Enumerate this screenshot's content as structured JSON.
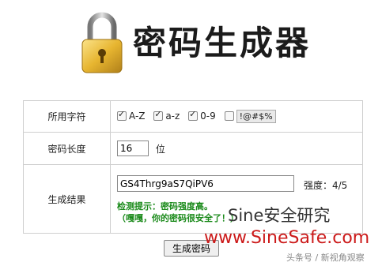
{
  "header": {
    "title": "密码生成器",
    "icon": "padlock-icon"
  },
  "form": {
    "charset": {
      "label": "所用字符",
      "options": [
        {
          "label": "A-Z",
          "checked": true
        },
        {
          "label": "a-z",
          "checked": true
        },
        {
          "label": "0-9",
          "checked": true
        },
        {
          "label": "!@#$%",
          "checked": false
        }
      ]
    },
    "length": {
      "label": "密码长度",
      "value": "16",
      "unit": "位"
    },
    "result": {
      "label": "生成结果",
      "password": "GS4Thrg9aS7QiPV6",
      "strength": "强度：4/5",
      "tip_line1": "检测提示：密码强度高。",
      "tip_line2": "（嘎嘎，你的密码很安全了！）"
    }
  },
  "actions": {
    "generate_label": "生成密码"
  },
  "watermark": {
    "brand": "Sine安全研究",
    "url": "www.SineSafe.com",
    "source": "头条号 / 新视角观察"
  },
  "colors": {
    "tip_green": "#1a8a1a",
    "lock_gold": "#e7b530",
    "url_red": "#cc1a1a"
  }
}
